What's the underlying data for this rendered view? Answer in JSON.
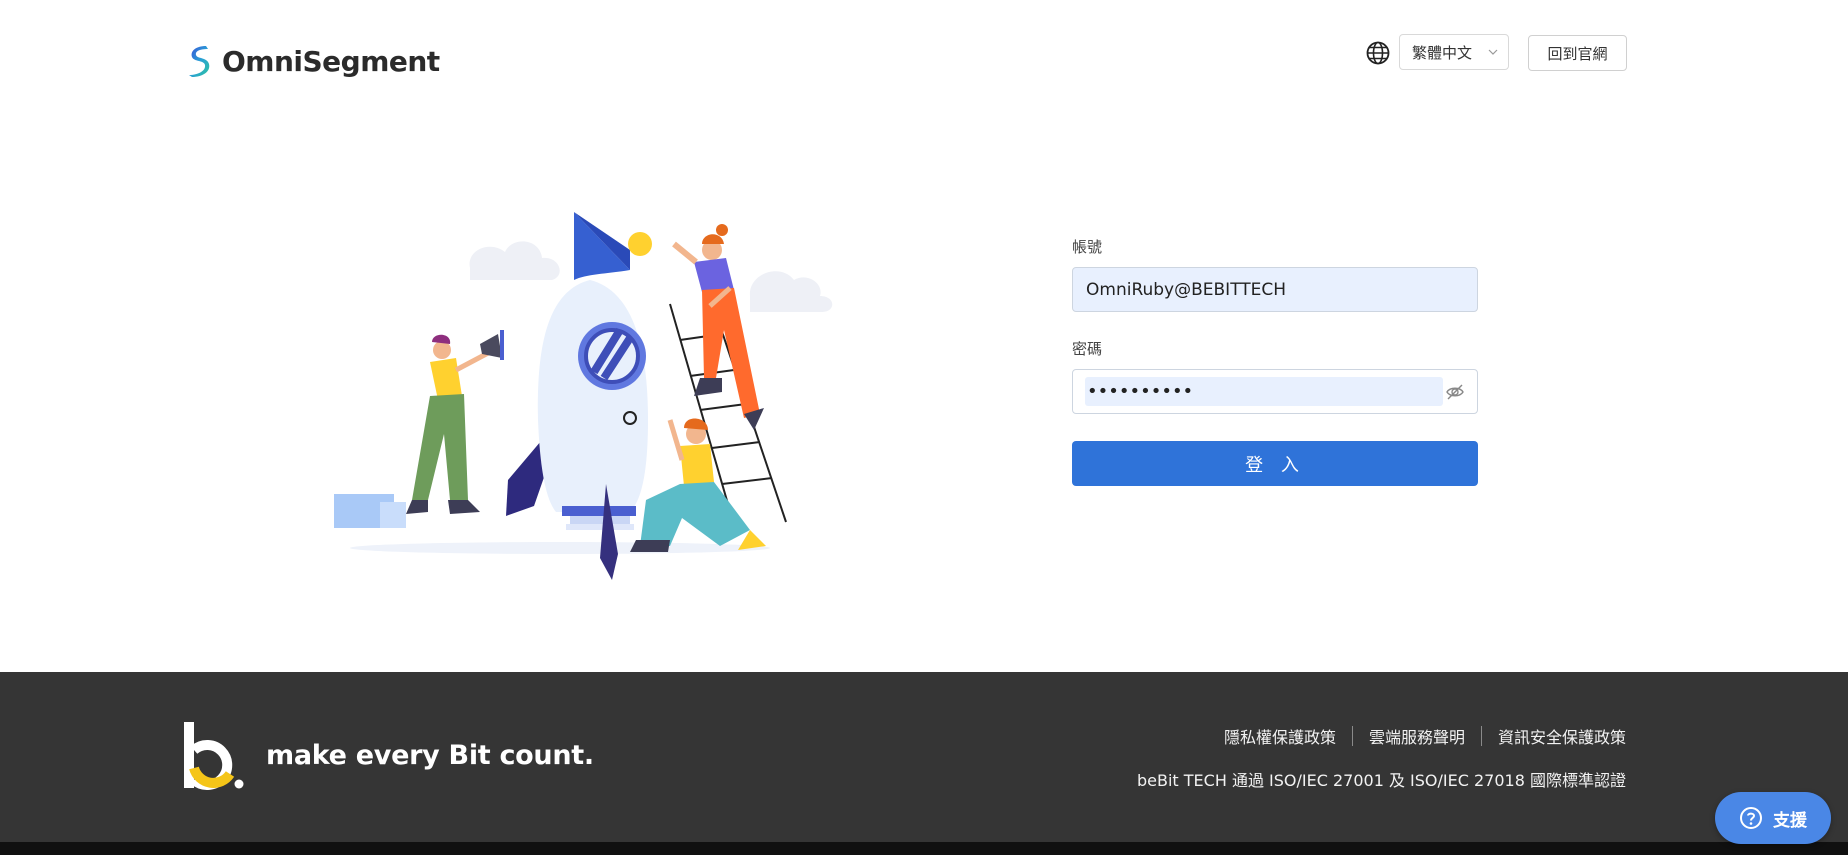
{
  "header": {
    "brand": "OmniSegment",
    "language": "繁體中文",
    "back_label": "回到官網"
  },
  "form": {
    "account_label": "帳號",
    "account_value": "OmniRuby@BEBITTECH",
    "password_label": "密碼",
    "password_value": "••••••••••",
    "login_label": "登 入"
  },
  "footer": {
    "tagline": "make every Bit count.",
    "links": [
      "隱私權保護政策",
      "雲端服務聲明",
      "資訊安全保護政策"
    ],
    "cert": "beBit TECH 通過 ISO/IEC 27001 及 ISO/IEC 27018 國際標準認證",
    "support_label": "支援"
  },
  "colors": {
    "primary": "#2f73d9",
    "footer_bg": "#353535",
    "input_bg": "#e8f0fe",
    "support_bg": "#4a87e6"
  },
  "icons": [
    "omnisegment-logo-icon",
    "globe-icon",
    "chevron-down-icon",
    "eye-off-icon",
    "bebit-logo-icon",
    "help-icon"
  ]
}
